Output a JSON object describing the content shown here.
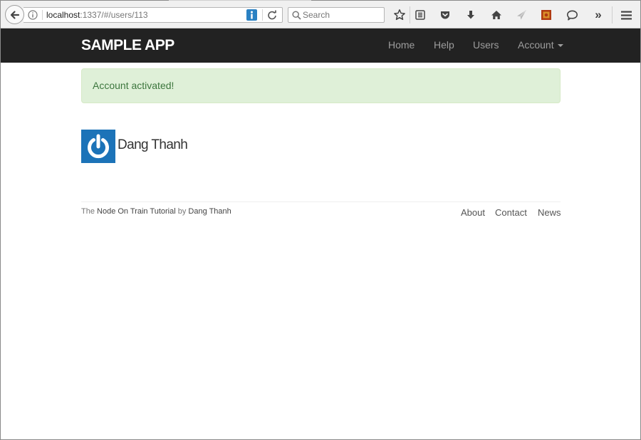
{
  "browser": {
    "url_host": "localhost",
    "url_rest": ":1337/#/users/113",
    "search_placeholder": "Search",
    "overflow_label": "»"
  },
  "navbar": {
    "brand": "SAMPLE APP",
    "items": [
      {
        "label": "Home"
      },
      {
        "label": "Help"
      },
      {
        "label": "Users"
      },
      {
        "label": "Account"
      }
    ]
  },
  "flash": {
    "message": "Account activated!"
  },
  "profile": {
    "name": "Dang Thanh"
  },
  "footer": {
    "prefix": "The ",
    "tutorial_link": "Node On Train Tutorial",
    "by": " by ",
    "author_link": "Dang Thanh",
    "links": [
      {
        "label": "About"
      },
      {
        "label": "Contact"
      },
      {
        "label": "News"
      }
    ]
  },
  "colors": {
    "navbar_bg": "#222222",
    "alert_bg": "#dff0d8",
    "alert_text": "#3c763d",
    "gravatar_bg": "#1c73b8"
  }
}
